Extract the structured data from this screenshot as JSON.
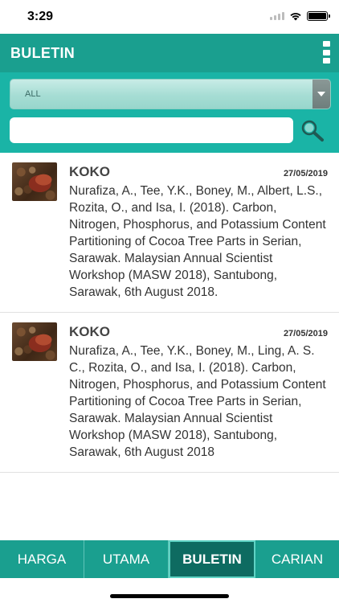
{
  "status_bar": {
    "time": "3:29"
  },
  "header": {
    "title": "BULETIN",
    "menu_icon": "kebab-menu-icon"
  },
  "filter": {
    "category_selected": "ALL",
    "search_value": "",
    "search_icon": "search-icon"
  },
  "items": [
    {
      "title": "KOKO",
      "date": "27/05/2019",
      "text": "Nurafiza, A., Tee, Y.K., Boney, M., Albert, L.S., Rozita, O., and Isa, I. (2018). Carbon, Nitrogen, Phosphorus, and Potassium Content Partitioning of Cocoa Tree Parts in Serian, Sarawak. Malaysian Annual Scientist Workshop (MASW 2018), Santubong, Sarawak, 6th August 2018."
    },
    {
      "title": "KOKO",
      "date": "27/05/2019",
      "text": "Nurafiza, A., Tee, Y.K., Boney, M., Ling, A. S. C., Rozita, O., and Isa, I. (2018). Carbon, Nitrogen, Phosphorus, and Potassium Content Partitioning of Cocoa Tree Parts in Serian, Sarawak. Malaysian Annual Scientist Workshop (MASW 2018), Santubong, Sarawak, 6th August 2018"
    }
  ],
  "tabs": [
    {
      "label": "HARGA",
      "active": false
    },
    {
      "label": "UTAMA",
      "active": false
    },
    {
      "label": "BULETIN",
      "active": true
    },
    {
      "label": "CARIAN",
      "active": false
    }
  ],
  "colors": {
    "header": "#1a9f8f",
    "filter_bg": "#1ab4a6",
    "active_tab": "#0e6b61"
  }
}
